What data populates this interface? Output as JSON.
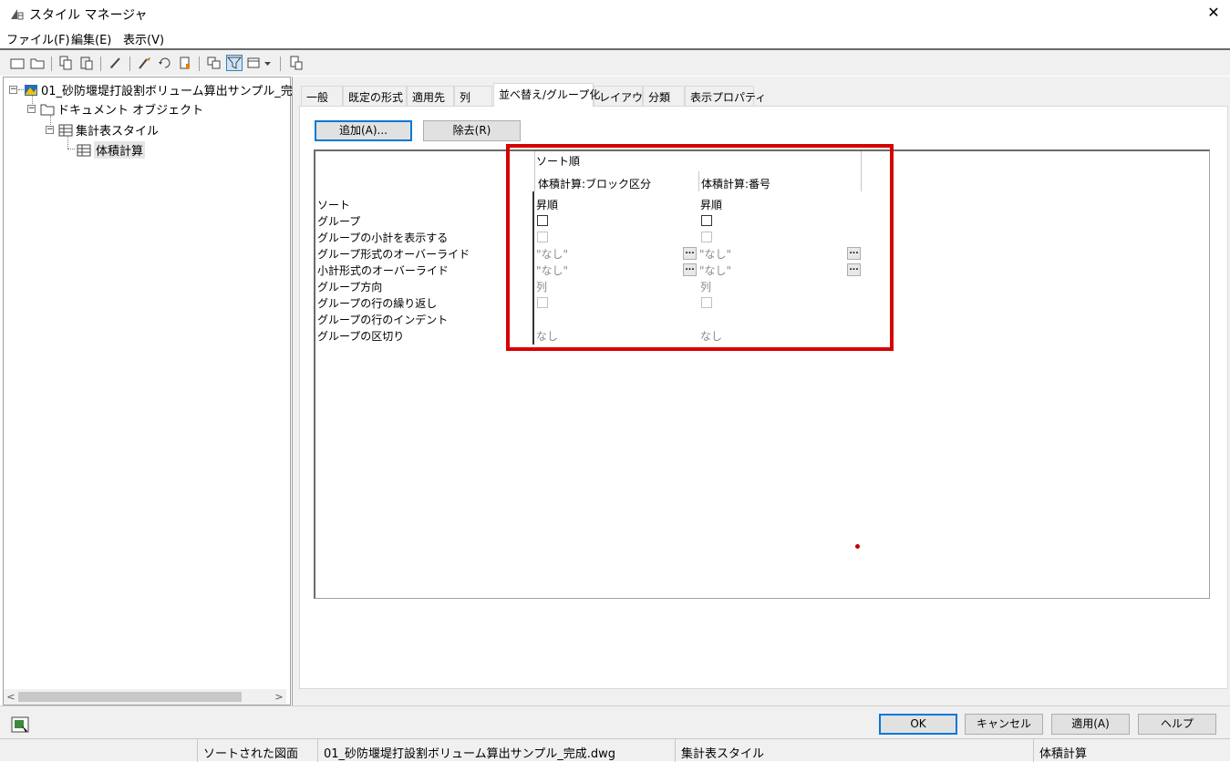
{
  "window": {
    "title": "スタイル マネージャ",
    "close_glyph": "✕"
  },
  "menu": [
    "ファイル(F)",
    "編集(E)",
    "表示(V)"
  ],
  "tree": {
    "root": "01_砂防堰堤打設割ボリューム算出サンプル_完",
    "doc_objects": "ドキュメント オブジェクト",
    "schedule_style": "集計表スタイル",
    "volume_calc": "体積計算"
  },
  "tabs": [
    "一般",
    "既定の形式",
    "適用先",
    "列",
    "並べ替え/グループ化",
    "レイアウト",
    "分類",
    "表示プロパティ"
  ],
  "buttons": {
    "add": "追加(A)...",
    "remove": "除去(R)"
  },
  "grid": {
    "header_group": "ソート順",
    "columns": [
      "体積計算:ブロック区分",
      "体積計算:番号"
    ],
    "row_labels": [
      "ソート",
      "グループ",
      "グループの小計を表示する",
      "グループ形式のオーバーライド",
      "小計形式のオーバーライド",
      "グループ方向",
      "グループの行の繰り返し",
      "グループの行のインデント",
      "グループの区切り"
    ],
    "col1": {
      "sort": "昇順",
      "group_override": "\"なし\"",
      "subtotal_override": "\"なし\"",
      "direction": "列",
      "separator": "なし"
    },
    "col2": {
      "sort": "昇順",
      "group_override": "\"なし\"",
      "subtotal_override": "\"なし\"",
      "direction": "列",
      "separator": "なし"
    },
    "ellipsis": "..."
  },
  "dialog_buttons": {
    "ok": "OK",
    "cancel": "キャンセル",
    "apply": "適用(A)",
    "help": "ヘルプ"
  },
  "status": [
    "ソートされた図面",
    "01_砂防堰堤打設割ボリューム算出サンプル_完成.dwg",
    "集計表スタイル",
    "体積計算"
  ],
  "scroll": {
    "left": "<",
    "right": ">"
  }
}
